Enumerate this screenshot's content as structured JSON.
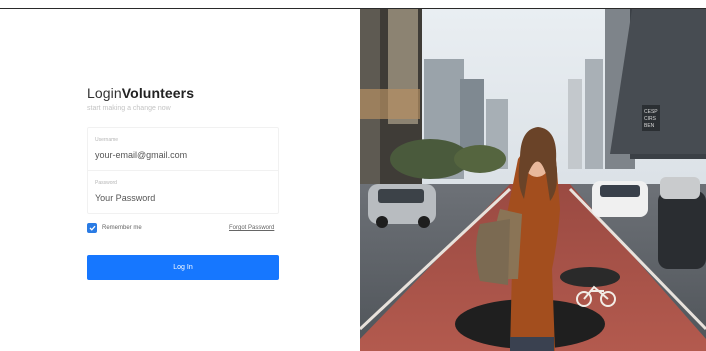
{
  "header": {
    "title_prefix": "Login",
    "title_brand": "Volunteers",
    "subtitle": "start making a change now"
  },
  "form": {
    "username_label": "Username",
    "username_value": "your-email@gmail.com",
    "password_label": "Password",
    "password_value": "Your Password",
    "remember_label": "Remember me",
    "remember_checked": true,
    "forgot_label": "Forgot Password",
    "login_label": "Log In"
  },
  "colors": {
    "accent": "#1677ff",
    "checkbox": "#2a7be4"
  },
  "photo": {
    "sign_text": "CESP CIRS BEN"
  }
}
